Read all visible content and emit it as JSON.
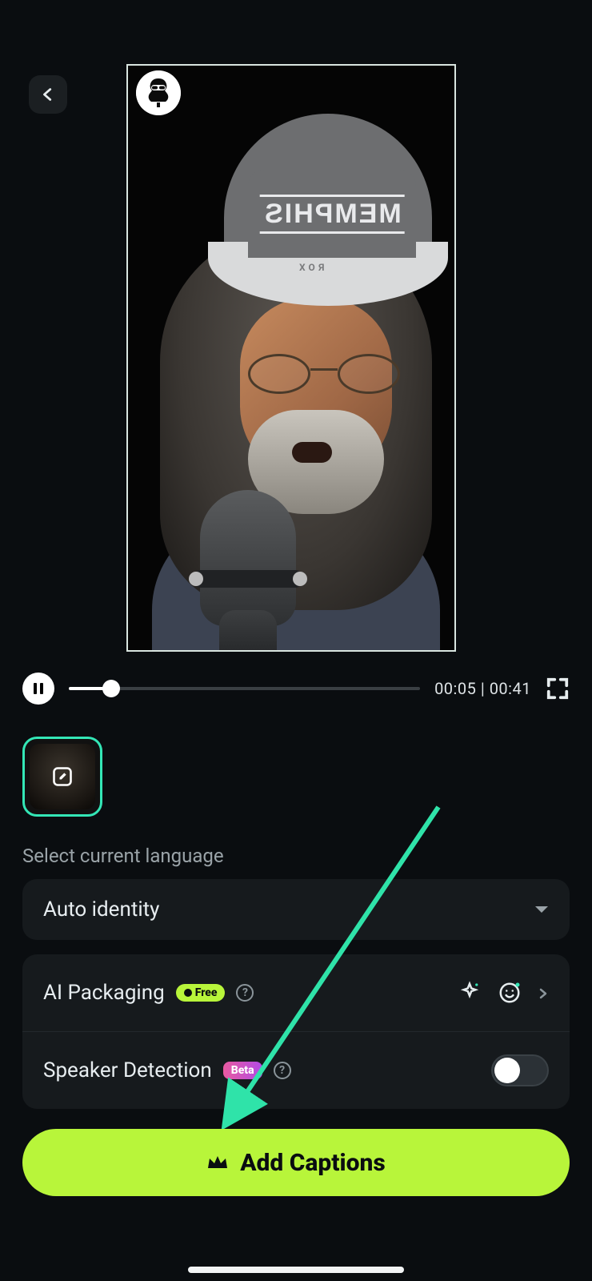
{
  "video": {
    "cap_label": "MEMPHIS",
    "cap_sub": "ROX"
  },
  "player": {
    "current_time": "00:05",
    "duration": "00:41",
    "progress_pct": 12
  },
  "language": {
    "label": "Select current language",
    "selected": "Auto identity"
  },
  "options": {
    "ai_packaging": {
      "title": "AI Packaging",
      "badge": "Free"
    },
    "speaker_detection": {
      "title": "Speaker Detection",
      "badge": "Beta",
      "enabled": false
    }
  },
  "cta": {
    "label": "Add Captions"
  }
}
